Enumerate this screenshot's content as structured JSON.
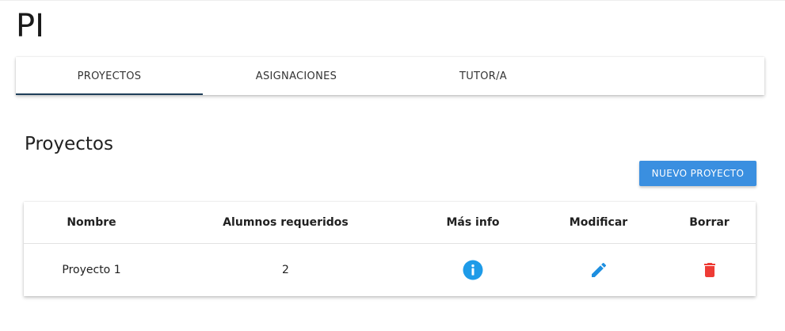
{
  "app": {
    "title": "PI"
  },
  "tabs": [
    {
      "label": "PROYECTOS",
      "active": true
    },
    {
      "label": "ASIGNACIONES",
      "active": false
    },
    {
      "label": "TUTOR/A",
      "active": false
    }
  ],
  "colors": {
    "primary": "#3a8fe0",
    "info": "#1e9be8",
    "edit": "#1e8fe0",
    "delete": "#ee3b35",
    "tab_indicator": "#1f3f5a"
  },
  "projects": {
    "title": "Proyectos",
    "new_button_label": "NUEVO PROYECTO",
    "table": {
      "columns": [
        "Nombre",
        "Alumnos requeridos",
        "Más info",
        "Modificar",
        "Borrar"
      ],
      "rows": [
        {
          "name": "Proyecto 1",
          "required_students": "2",
          "info_icon": "info-icon",
          "edit_icon": "pencil-icon",
          "delete_icon": "trash-icon"
        }
      ]
    }
  }
}
